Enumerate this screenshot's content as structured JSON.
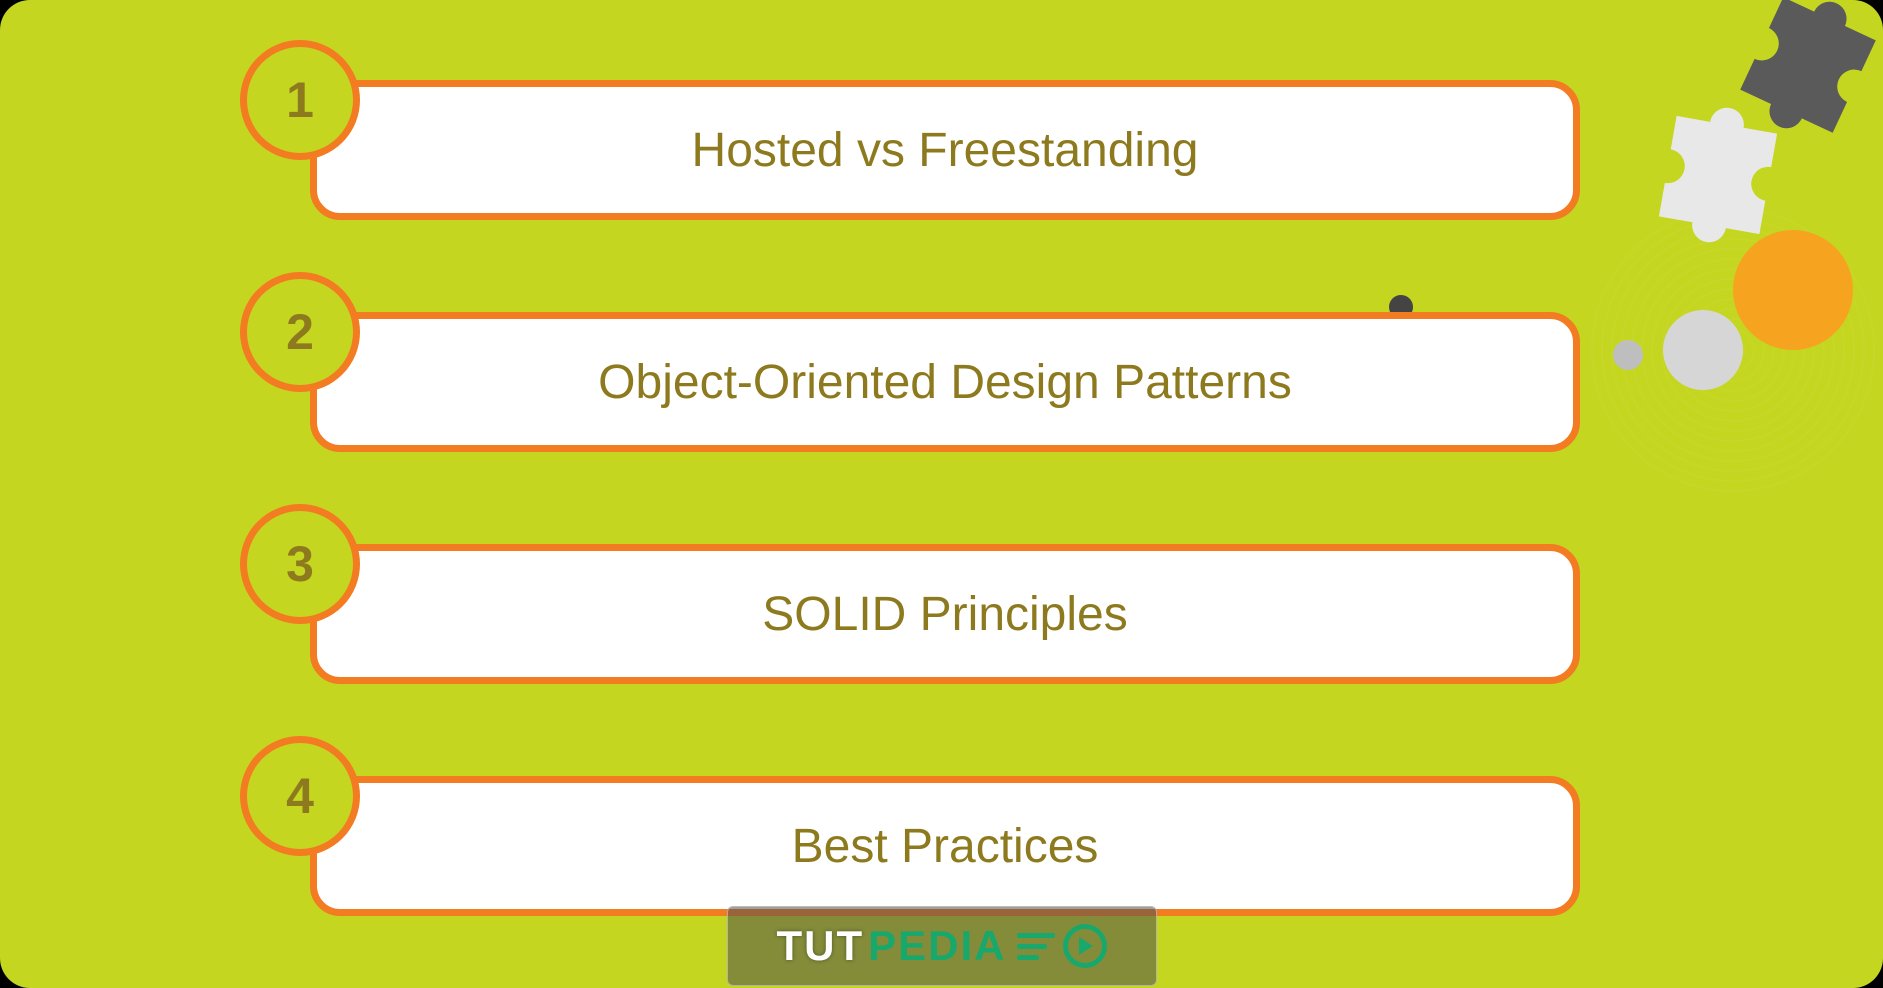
{
  "items": [
    {
      "number": "1",
      "title": "Hosted vs Freestanding"
    },
    {
      "number": "2",
      "title": "Object-Oriented Design Patterns"
    },
    {
      "number": "3",
      "title": "SOLID Principles"
    },
    {
      "number": "4",
      "title": "Best Practices"
    }
  ],
  "logo": {
    "part1": "TUT",
    "part2": "PEDIA"
  }
}
